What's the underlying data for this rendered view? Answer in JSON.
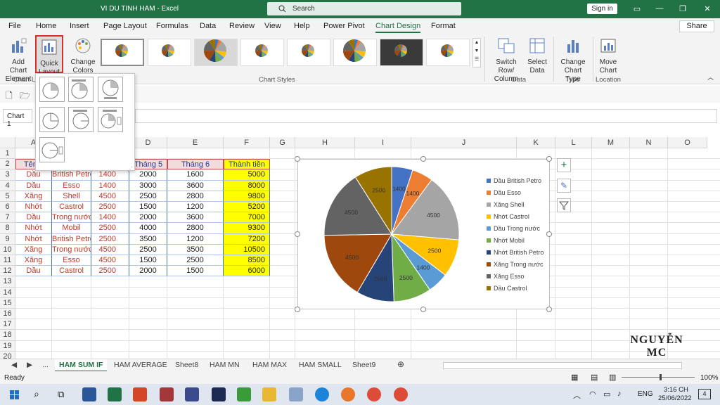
{
  "window": {
    "title": "VI DU TINH HAM  -  Excel",
    "search_placeholder": "Search",
    "signin": "Sign in"
  },
  "menu": {
    "tabs": [
      "File",
      "Home",
      "Insert",
      "Page Layout",
      "Formulas",
      "Data",
      "Review",
      "View",
      "Help",
      "Power Pivot",
      "Chart Design",
      "Format"
    ],
    "active": "Chart Design",
    "share": "Share"
  },
  "ribbon": {
    "add_chart_element": "Add Chart Element",
    "quick_layout": "Quick Layout",
    "change_colors": "Change Colors",
    "switch_row_column": "Switch Row/ Column",
    "select_data": "Select Data",
    "change_chart_type": "Change Chart Type",
    "move_chart": "Move Chart",
    "group_chart_layouts": "Chart La",
    "group_chart_styles": "Chart Styles",
    "group_data": "Data",
    "group_type": "Type",
    "group_location": "Location"
  },
  "namebox": "Chart 1",
  "columns": [
    "A",
    "B",
    "C",
    "D",
    "E",
    "F",
    "G",
    "H",
    "I",
    "J",
    "K",
    "L",
    "M",
    "N",
    "O"
  ],
  "rows": [
    "1",
    "2",
    "3",
    "4",
    "5",
    "6",
    "7",
    "8",
    "9",
    "10",
    "11",
    "12",
    "13",
    "14",
    "15",
    "16",
    "17",
    "18",
    "19",
    "20",
    "21"
  ],
  "table": {
    "headers": [
      "Tên h",
      "",
      "",
      "Tháng 5",
      "Tháng 6",
      "Thành tiền"
    ],
    "rows": [
      [
        "Dầu",
        "British Petro",
        "1400",
        "2000",
        "1600",
        "5000"
      ],
      [
        "Dầu",
        "Esso",
        "1400",
        "3000",
        "3600",
        "8000"
      ],
      [
        "Xăng",
        "Shell",
        "4500",
        "2500",
        "2800",
        "9800"
      ],
      [
        "Nhớt",
        "Castrol",
        "2500",
        "1500",
        "1200",
        "5200"
      ],
      [
        "Dầu",
        "Trong nước",
        "1400",
        "2000",
        "3600",
        "7000"
      ],
      [
        "Nhớt",
        "Mobil",
        "2500",
        "4000",
        "2800",
        "9300"
      ],
      [
        "Nhớt",
        "British Petro",
        "2500",
        "3500",
        "1200",
        "7200"
      ],
      [
        "Xăng",
        "Trong nước",
        "4500",
        "2500",
        "3500",
        "10500"
      ],
      [
        "Xăng",
        "Esso",
        "4500",
        "1500",
        "2500",
        "8500"
      ],
      [
        "Dầu",
        "Castrol",
        "2500",
        "2000",
        "1500",
        "6000"
      ]
    ]
  },
  "chart_data": {
    "type": "pie",
    "categories": [
      "Dầu British Petro",
      "Dầu Esso",
      "Xăng Shell",
      "Nhớt Castrol",
      "Dầu Trong nước",
      "Nhớt Mobil",
      "Nhớt British Petro",
      "Xăng Trong nước",
      "Xăng Esso",
      "Dầu Castrol"
    ],
    "values": [
      1400,
      1400,
      4500,
      2500,
      1400,
      2500,
      2500,
      4500,
      4500,
      2500
    ],
    "colors": [
      "#4472c4",
      "#ed7d31",
      "#a5a5a5",
      "#ffc000",
      "#5b9bd5",
      "#70ad47",
      "#264478",
      "#9e480e",
      "#636363",
      "#997300"
    ],
    "legend": "right"
  },
  "sheets": [
    "...",
    "HAM SUM IF",
    "HAM AVERAGE",
    "Sheet8",
    "HAM MN",
    "HAM MAX",
    "HAM SMALL",
    "Sheet9"
  ],
  "active_sheet": "HAM SUM IF",
  "status": {
    "ready": "Ready",
    "zoom": "100%"
  },
  "watermark": "NGUYỄN MC",
  "taskbar": {
    "lang": "ENG",
    "time": "3:16 CH",
    "date": "25/06/2022",
    "notif": "4"
  }
}
